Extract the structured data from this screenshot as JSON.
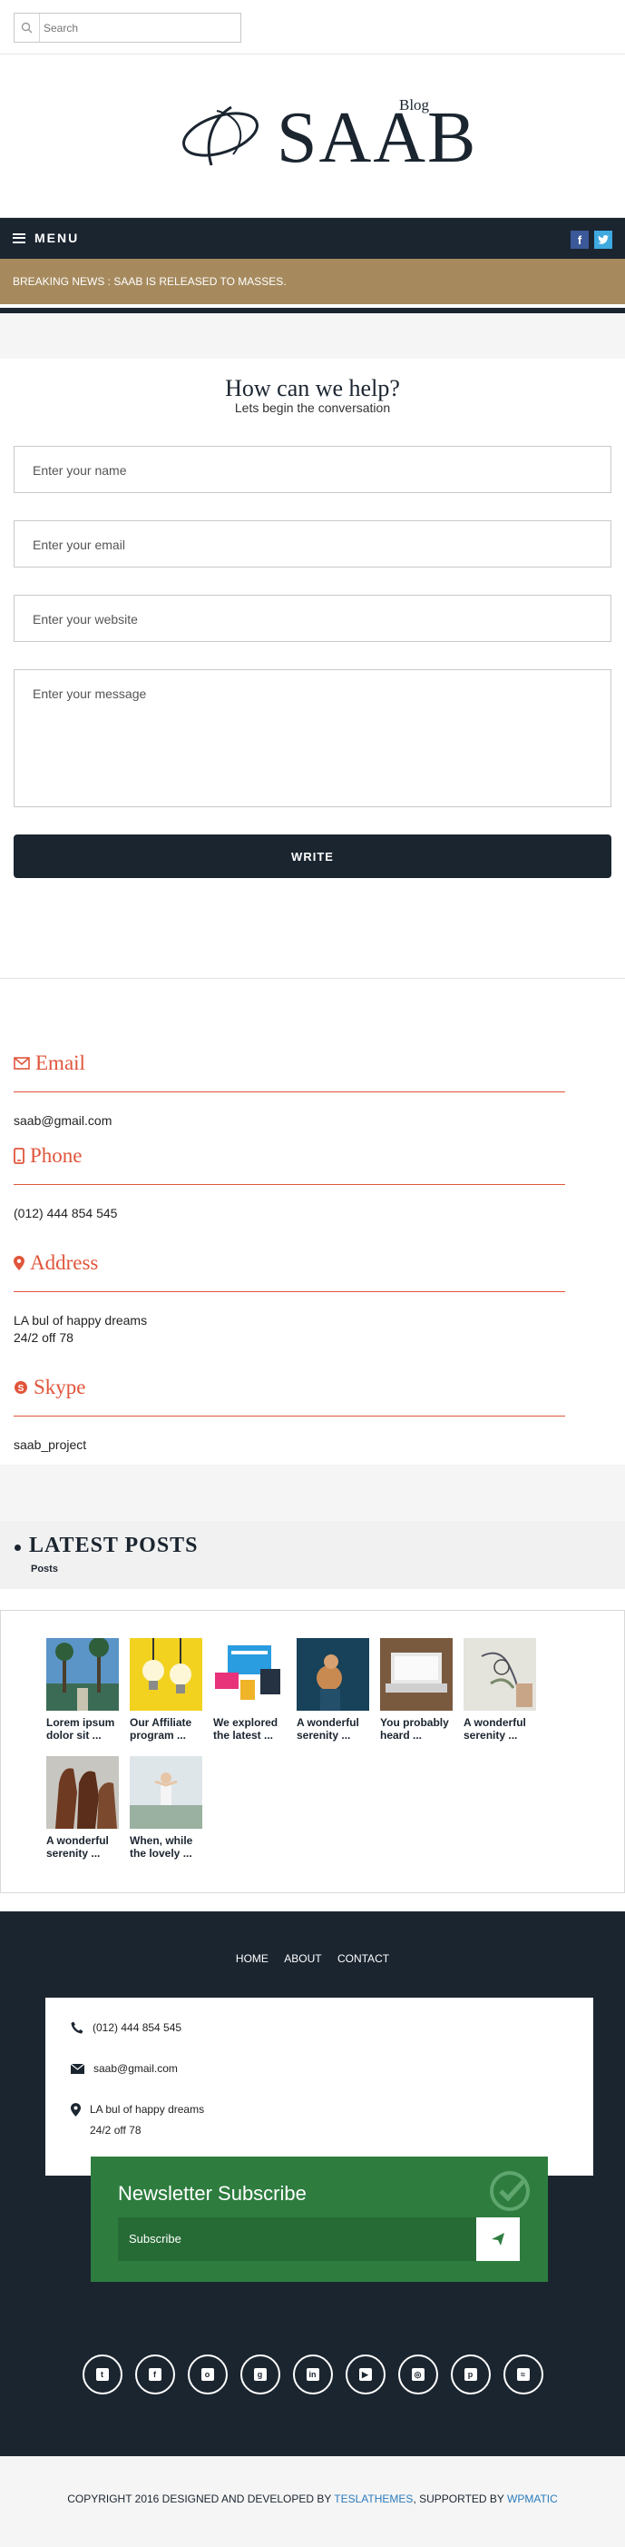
{
  "search": {
    "placeholder": "Search"
  },
  "logo": {
    "text": "SAAB",
    "tag": "Blog"
  },
  "menu": {
    "label": "MENU"
  },
  "breaking": {
    "text": "BREAKING NEWS : SAAB IS RELEASED TO MASSES."
  },
  "help": {
    "title": "How can we help?",
    "subtitle": "Lets begin the conversation"
  },
  "form": {
    "name_placeholder": "Enter your name",
    "email_placeholder": "Enter your email",
    "website_placeholder": "Enter your website",
    "message_placeholder": "Enter your message",
    "submit_label": "WRITE"
  },
  "contact": {
    "email_heading": "Email",
    "email_value": "saab@gmail.com",
    "phone_heading": "Phone",
    "phone_value": "(012) 444 854 545",
    "address_heading": "Address",
    "address_line1": "LA bul of happy dreams",
    "address_line2": "24/2 off 78",
    "skype_heading": "Skype",
    "skype_value": "saab_project"
  },
  "latest": {
    "title": "LATEST POSTS",
    "subtitle": "Posts"
  },
  "posts": [
    {
      "title": "Lorem ipsum dolor sit ..."
    },
    {
      "title": "Our Affiliate program ..."
    },
    {
      "title": "We explored the latest ..."
    },
    {
      "title": "A wonderful serenity ..."
    },
    {
      "title": "You probably heard ..."
    },
    {
      "title": "A wonderful serenity ..."
    },
    {
      "title": "A wonderful serenity ..."
    },
    {
      "title": "When, while the lovely ..."
    }
  ],
  "footer": {
    "nav": [
      "HOME",
      "ABOUT",
      "CONTACT"
    ],
    "phone": "(012) 444 854 545",
    "email": "saab@gmail.com",
    "address_line1": "LA bul of happy dreams",
    "address_line2": "24/2 off 78",
    "newsletter_title": "Newsletter Subscribe",
    "newsletter_placeholder": "Subscribe"
  },
  "copyright": {
    "prefix": "COPYRIGHT 2016 DESIGNED AND DEVELOPED BY ",
    "link1": "TESLATHEMES",
    "middle": ", SUPPORTED BY ",
    "link2": "WPMATIC"
  },
  "colors": {
    "dark": "#1b2530",
    "accent": "#e0553b",
    "gold": "#a68a5e",
    "green": "#2e7d3f",
    "link": "#2b7bbd"
  },
  "icons": [
    "search-icon",
    "facebook-icon",
    "twitter-icon",
    "envelope-icon",
    "mobile-icon",
    "map-marker-icon",
    "skype-icon",
    "phone-icon",
    "send-icon",
    "check-icon"
  ]
}
